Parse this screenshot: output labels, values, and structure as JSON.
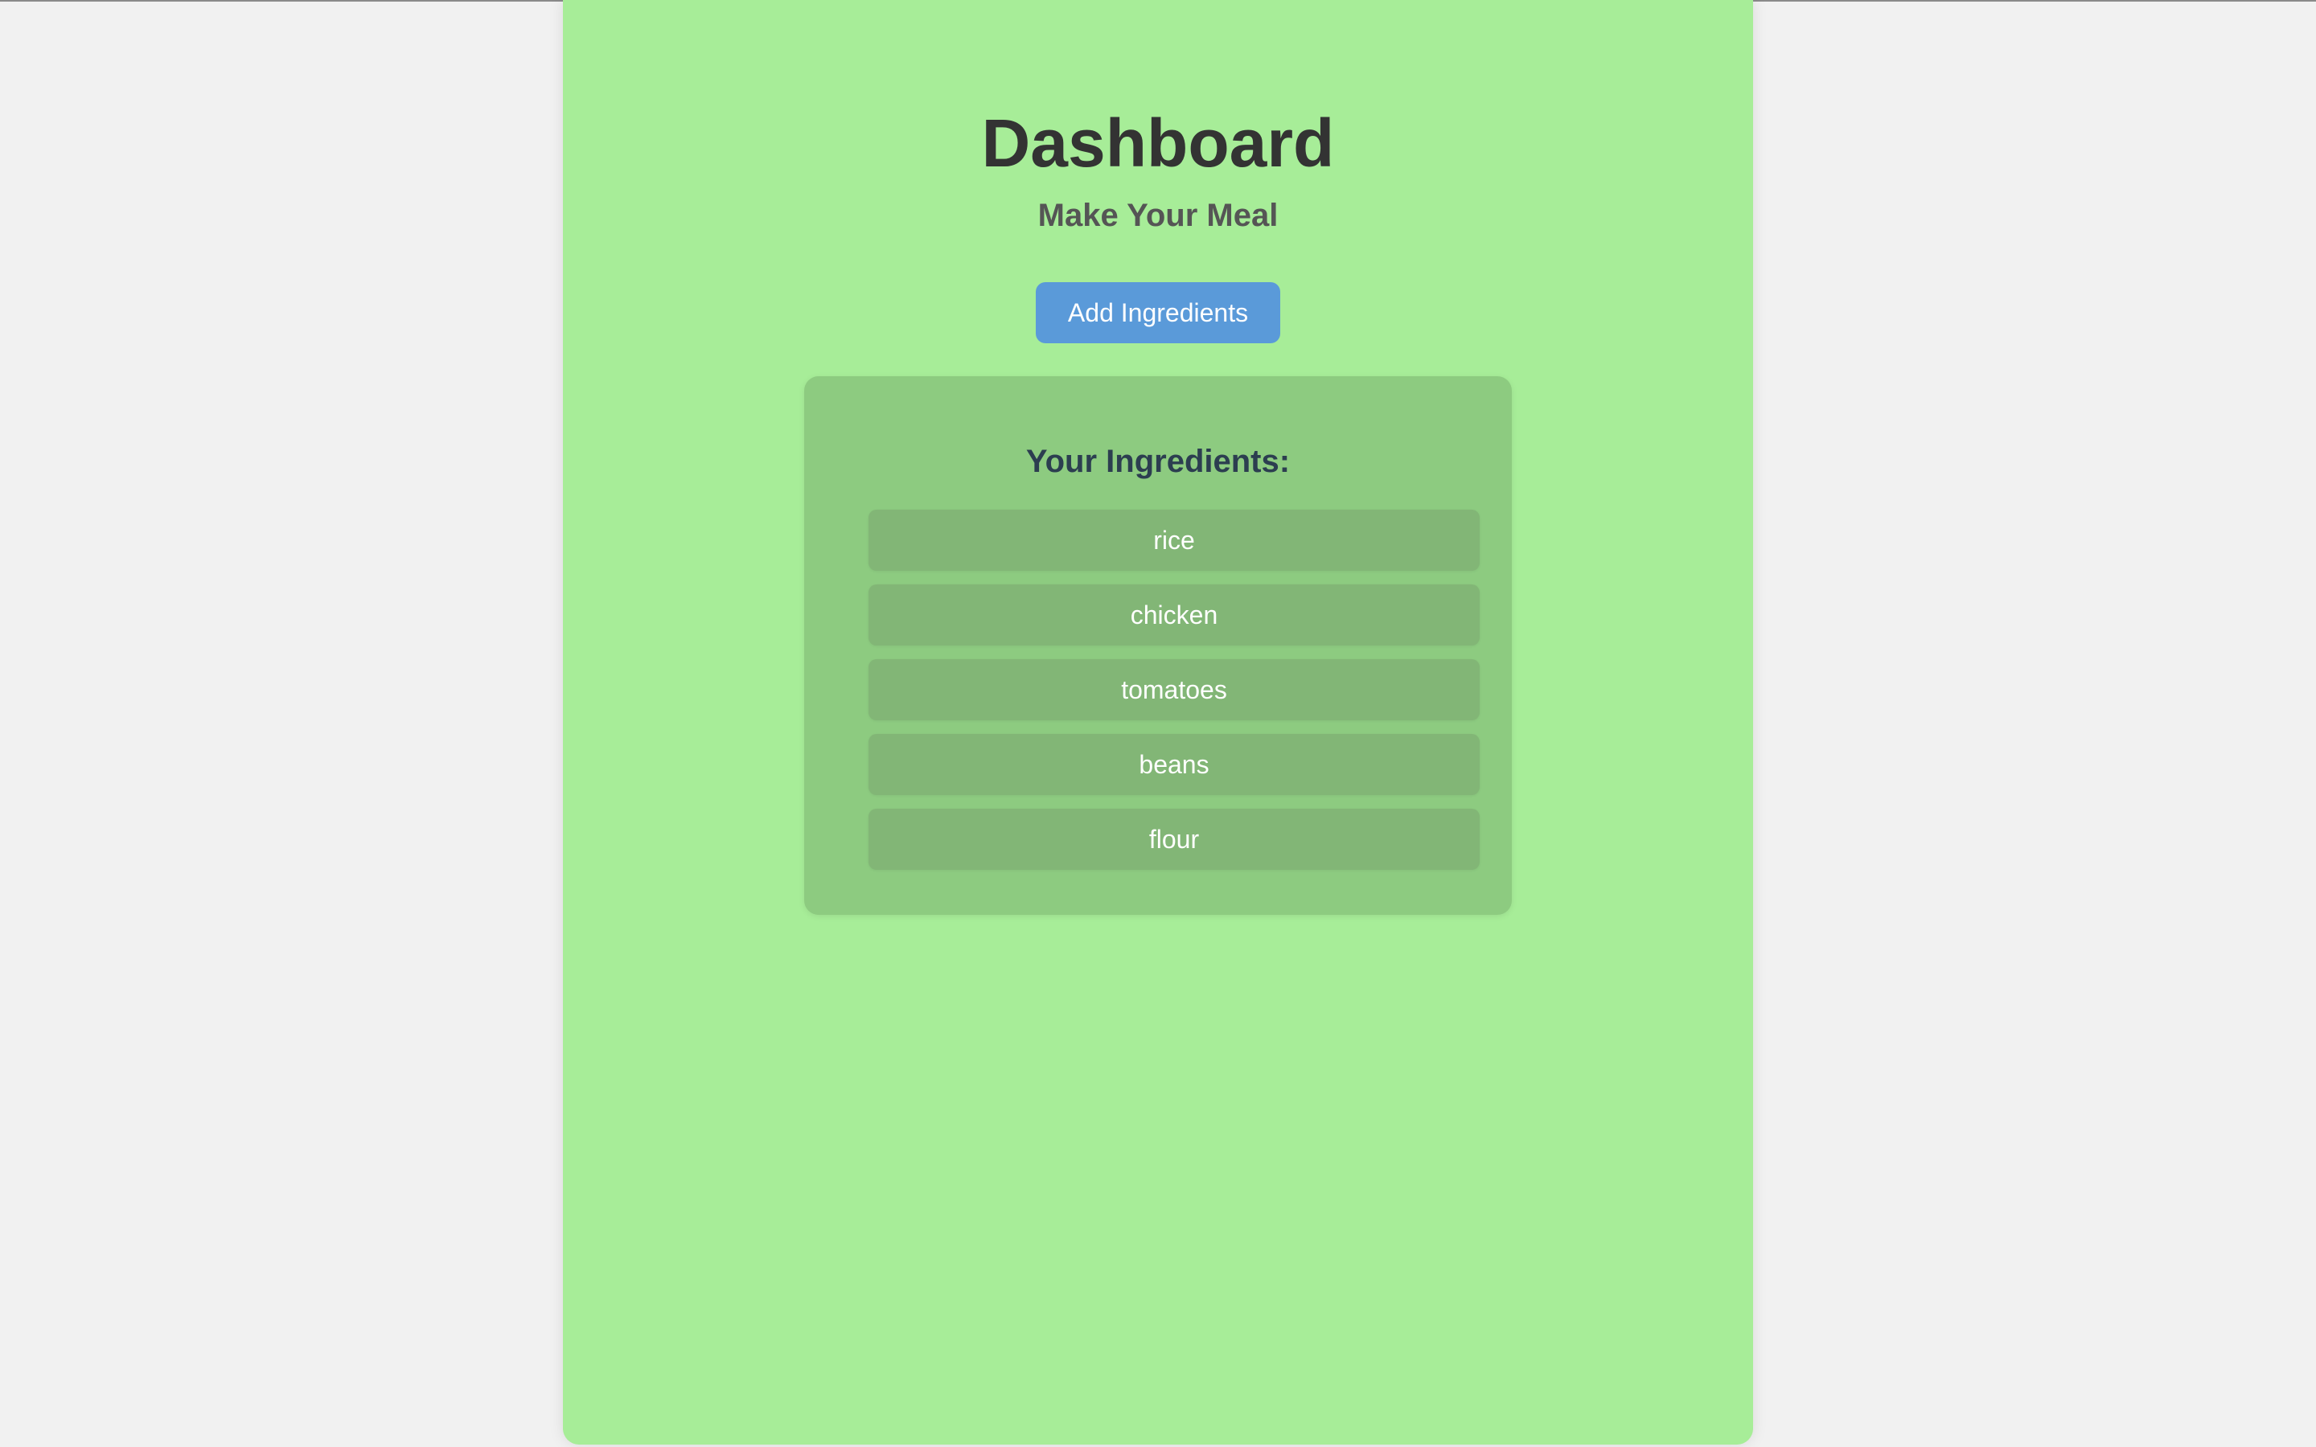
{
  "header": {
    "title": "Dashboard",
    "subtitle": "Make Your Meal"
  },
  "actions": {
    "add_ingredients_label": "Add Ingredients"
  },
  "ingredients": {
    "heading": "Your Ingredients:",
    "items": [
      "rice",
      "chicken",
      "tomatoes",
      "beans",
      "flour"
    ]
  },
  "colors": {
    "page_background": "#f1f1f1",
    "card_background": "#a7ed98",
    "panel_background": "#8dcb80",
    "item_background": "#82b676",
    "button_background": "#5a9ad9",
    "heading_text": "#2c3e50"
  }
}
